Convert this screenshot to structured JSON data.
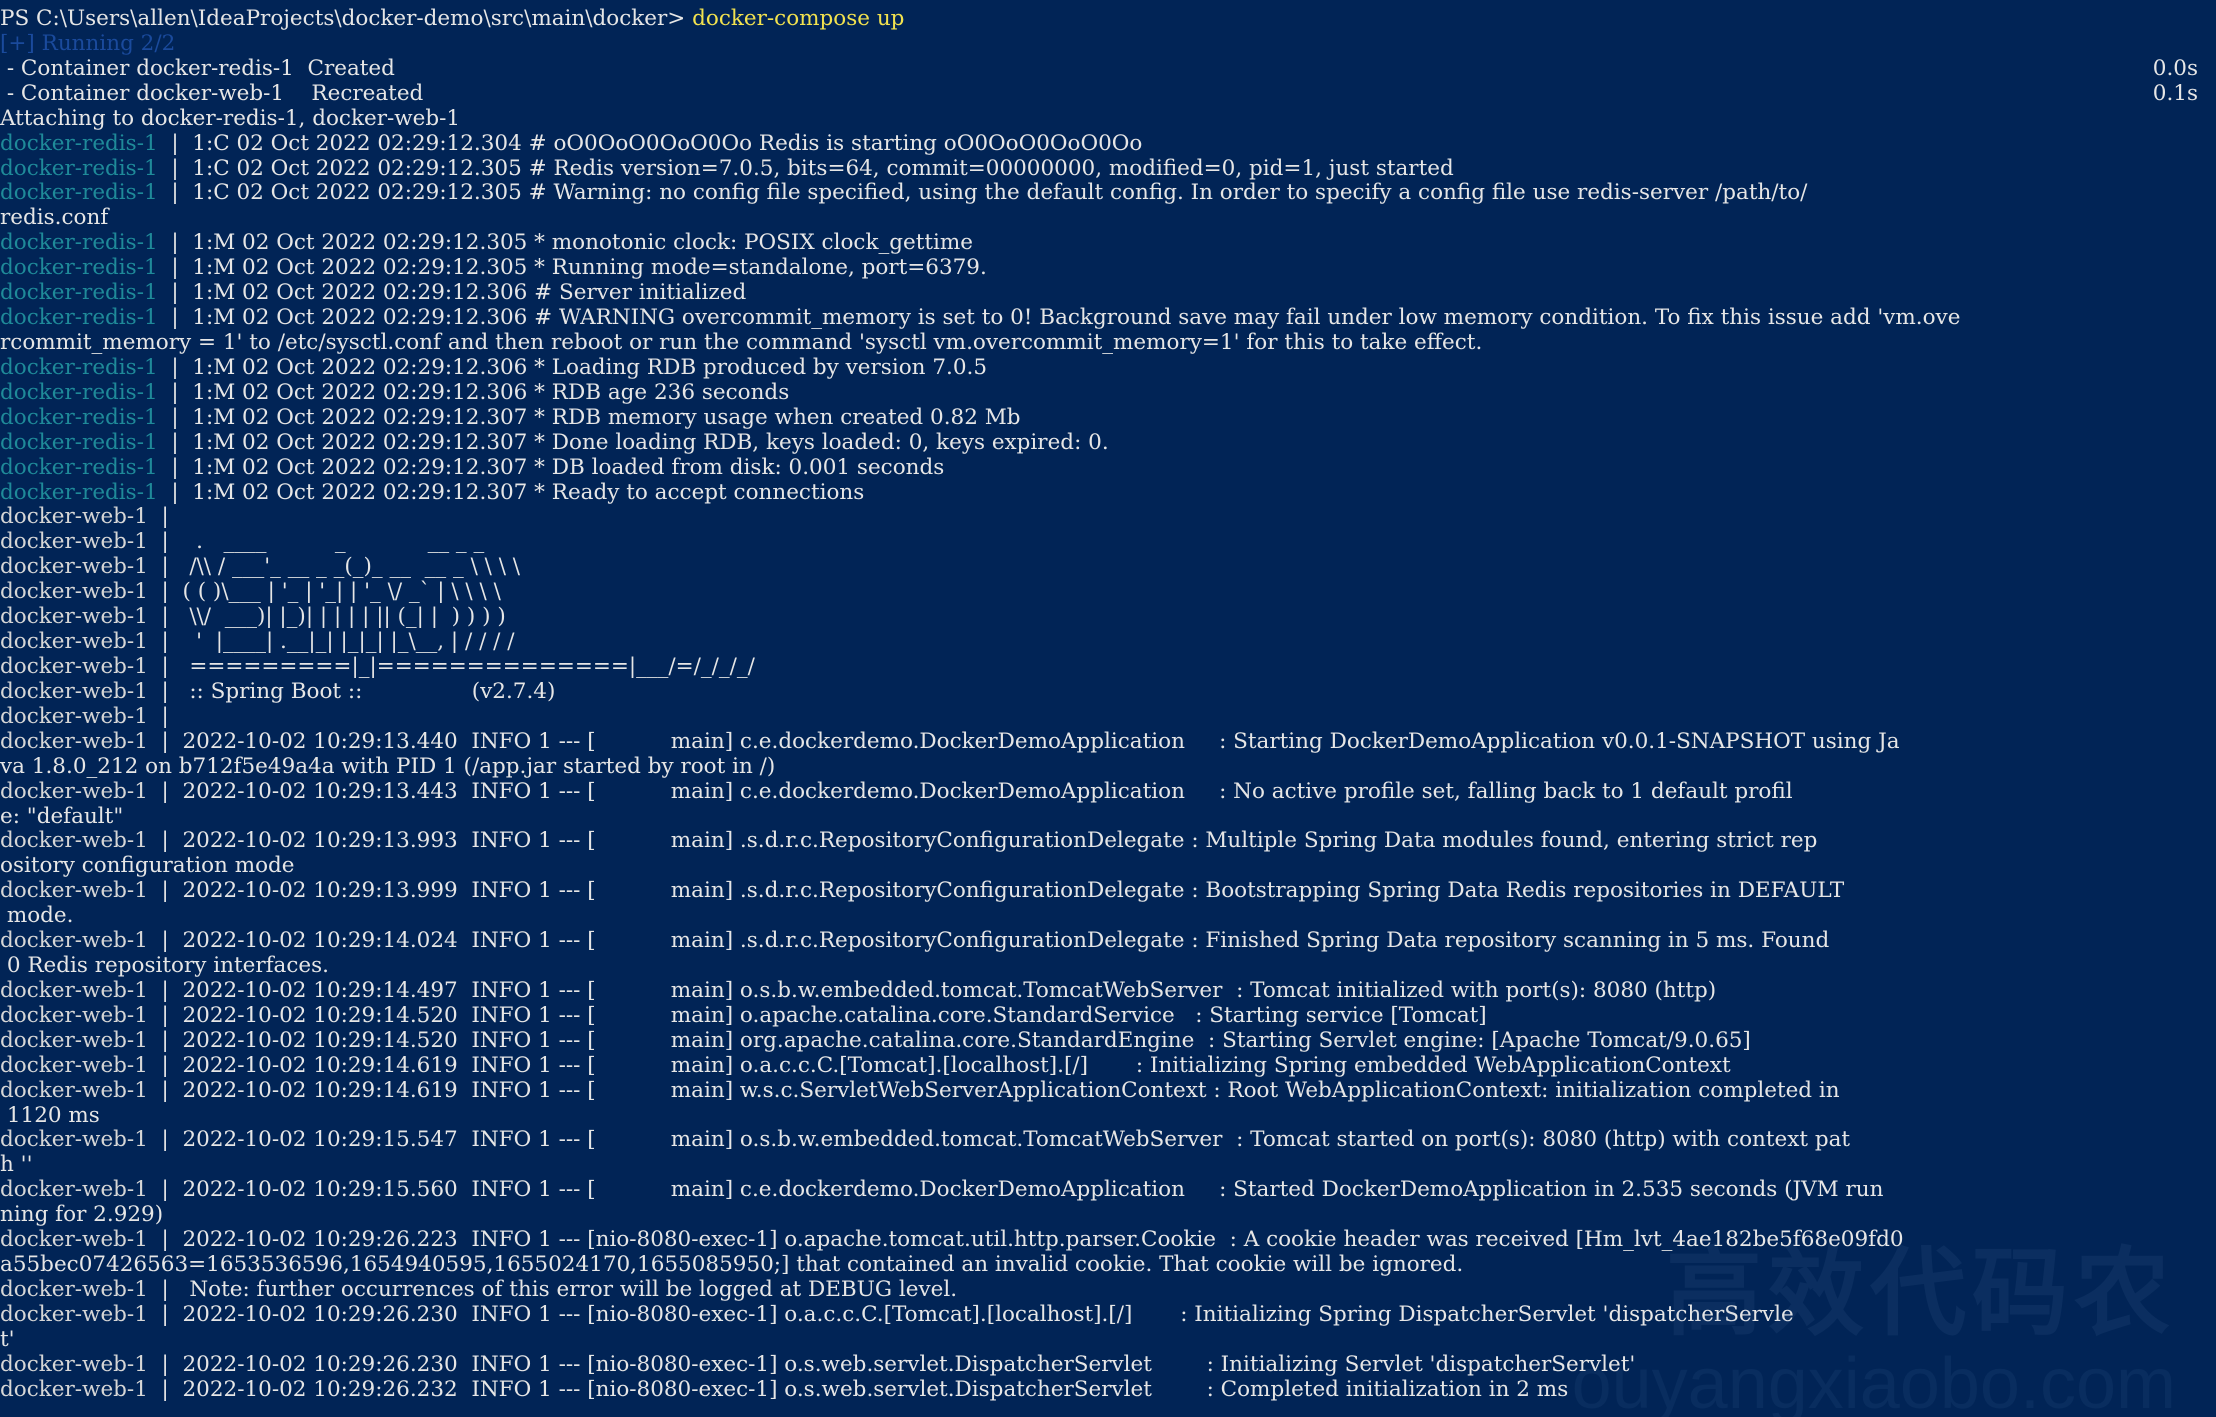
{
  "terminal": {
    "prompt": "PS C:\\Users\\allen\\IdeaProjects\\docker-demo\\src\\main\\docker> ",
    "command": "docker-compose up",
    "running_status": "[+] Running 2/2",
    "containers": [
      {
        "text": " - Container docker-redis-1  Created",
        "time": "0.0s"
      },
      {
        "text": " - Container docker-web-1    Recreated",
        "time": "0.1s"
      }
    ],
    "attaching": "Attaching to docker-redis-1, docker-web-1",
    "watermark": {
      "line1": "高效代码农",
      "line2": "ouyangxiaobo.com"
    }
  },
  "log_lines": [
    {
      "svc": "docker-redis-1",
      "text": "1:C 02 Oct 2022 02:29:12.304 # oO0OoO0OoO0Oo Redis is starting oO0OoO0OoO0Oo"
    },
    {
      "svc": "docker-redis-1",
      "text": "1:C 02 Oct 2022 02:29:12.305 # Redis version=7.0.5, bits=64, commit=00000000, modified=0, pid=1, just started"
    },
    {
      "svc": "docker-redis-1",
      "text": "1:C 02 Oct 2022 02:29:12.305 # Warning: no config file specified, using the default config. In order to specify a config file use redis-server /path/to/"
    },
    {
      "svc": "",
      "text": "redis.conf"
    },
    {
      "svc": "docker-redis-1",
      "text": "1:M 02 Oct 2022 02:29:12.305 * monotonic clock: POSIX clock_gettime"
    },
    {
      "svc": "docker-redis-1",
      "text": "1:M 02 Oct 2022 02:29:12.305 * Running mode=standalone, port=6379."
    },
    {
      "svc": "docker-redis-1",
      "text": "1:M 02 Oct 2022 02:29:12.306 # Server initialized"
    },
    {
      "svc": "docker-redis-1",
      "text": "1:M 02 Oct 2022 02:29:12.306 # WARNING overcommit_memory is set to 0! Background save may fail under low memory condition. To fix this issue add 'vm.ove"
    },
    {
      "svc": "",
      "text": "rcommit_memory = 1' to /etc/sysctl.conf and then reboot or run the command 'sysctl vm.overcommit_memory=1' for this to take effect."
    },
    {
      "svc": "docker-redis-1",
      "text": "1:M 02 Oct 2022 02:29:12.306 * Loading RDB produced by version 7.0.5"
    },
    {
      "svc": "docker-redis-1",
      "text": "1:M 02 Oct 2022 02:29:12.306 * RDB age 236 seconds"
    },
    {
      "svc": "docker-redis-1",
      "text": "1:M 02 Oct 2022 02:29:12.307 * RDB memory usage when created 0.82 Mb"
    },
    {
      "svc": "docker-redis-1",
      "text": "1:M 02 Oct 2022 02:29:12.307 * Done loading RDB, keys loaded: 0, keys expired: 0."
    },
    {
      "svc": "docker-redis-1",
      "text": "1:M 02 Oct 2022 02:29:12.307 * DB loaded from disk: 0.001 seconds"
    },
    {
      "svc": "docker-redis-1",
      "text": "1:M 02 Oct 2022 02:29:12.307 * Ready to accept connections"
    },
    {
      "svc": "docker-web-1",
      "text": ""
    },
    {
      "svc": "docker-web-1",
      "text": "  .   ____          _            __ _ _"
    },
    {
      "svc": "docker-web-1",
      "text": " /\\\\ / ___'_ __ _ _(_)_ __  __ _ \\ \\ \\ \\"
    },
    {
      "svc": "docker-web-1",
      "text": "( ( )\\___ | '_ | '_| | '_ \\/ _` | \\ \\ \\ \\"
    },
    {
      "svc": "docker-web-1",
      "text": " \\\\/  ___)| |_)| | | | | || (_| |  ) ) ) )"
    },
    {
      "svc": "docker-web-1",
      "text": "  '  |____| .__|_| |_|_| |_\\__, | / / / /"
    },
    {
      "svc": "docker-web-1",
      "text": " =========|_|==============|___/=/_/_/_/"
    },
    {
      "svc": "docker-web-1",
      "text": " :: Spring Boot ::                (v2.7.4)"
    },
    {
      "svc": "docker-web-1",
      "text": ""
    },
    {
      "svc": "docker-web-1",
      "text": "2022-10-02 10:29:13.440  INFO 1 --- [           main] c.e.dockerdemo.DockerDemoApplication     : Starting DockerDemoApplication v0.0.1-SNAPSHOT using Ja"
    },
    {
      "svc": "",
      "text": "va 1.8.0_212 on b712f5e49a4a with PID 1 (/app.jar started by root in /)"
    },
    {
      "svc": "docker-web-1",
      "text": "2022-10-02 10:29:13.443  INFO 1 --- [           main] c.e.dockerdemo.DockerDemoApplication     : No active profile set, falling back to 1 default profil"
    },
    {
      "svc": "",
      "text": "e: \"default\""
    },
    {
      "svc": "docker-web-1",
      "text": "2022-10-02 10:29:13.993  INFO 1 --- [           main] .s.d.r.c.RepositoryConfigurationDelegate : Multiple Spring Data modules found, entering strict rep"
    },
    {
      "svc": "",
      "text": "ository configuration mode"
    },
    {
      "svc": "docker-web-1",
      "text": "2022-10-02 10:29:13.999  INFO 1 --- [           main] .s.d.r.c.RepositoryConfigurationDelegate : Bootstrapping Spring Data Redis repositories in DEFAULT"
    },
    {
      "svc": "",
      "text": " mode."
    },
    {
      "svc": "docker-web-1",
      "text": "2022-10-02 10:29:14.024  INFO 1 --- [           main] .s.d.r.c.RepositoryConfigurationDelegate : Finished Spring Data repository scanning in 5 ms. Found"
    },
    {
      "svc": "",
      "text": " 0 Redis repository interfaces."
    },
    {
      "svc": "docker-web-1",
      "text": "2022-10-02 10:29:14.497  INFO 1 --- [           main] o.s.b.w.embedded.tomcat.TomcatWebServer  : Tomcat initialized with port(s): 8080 (http)"
    },
    {
      "svc": "docker-web-1",
      "text": "2022-10-02 10:29:14.520  INFO 1 --- [           main] o.apache.catalina.core.StandardService   : Starting service [Tomcat]"
    },
    {
      "svc": "docker-web-1",
      "text": "2022-10-02 10:29:14.520  INFO 1 --- [           main] org.apache.catalina.core.StandardEngine  : Starting Servlet engine: [Apache Tomcat/9.0.65]"
    },
    {
      "svc": "docker-web-1",
      "text": "2022-10-02 10:29:14.619  INFO 1 --- [           main] o.a.c.c.C.[Tomcat].[localhost].[/]       : Initializing Spring embedded WebApplicationContext"
    },
    {
      "svc": "docker-web-1",
      "text": "2022-10-02 10:29:14.619  INFO 1 --- [           main] w.s.c.ServletWebServerApplicationContext : Root WebApplicationContext: initialization completed in"
    },
    {
      "svc": "",
      "text": " 1120 ms"
    },
    {
      "svc": "docker-web-1",
      "text": "2022-10-02 10:29:15.547  INFO 1 --- [           main] o.s.b.w.embedded.tomcat.TomcatWebServer  : Tomcat started on port(s): 8080 (http) with context pat"
    },
    {
      "svc": "",
      "text": "h ''"
    },
    {
      "svc": "docker-web-1",
      "text": "2022-10-02 10:29:15.560  INFO 1 --- [           main] c.e.dockerdemo.DockerDemoApplication     : Started DockerDemoApplication in 2.535 seconds (JVM run"
    },
    {
      "svc": "",
      "text": "ning for 2.929)"
    },
    {
      "svc": "docker-web-1",
      "text": "2022-10-02 10:29:26.223  INFO 1 --- [nio-8080-exec-1] o.apache.tomcat.util.http.parser.Cookie  : A cookie header was received [Hm_lvt_4ae182be5f68e09fd0"
    },
    {
      "svc": "",
      "text": "a55bec07426563=1653536596,1654940595,1655024170,1655085950;] that contained an invalid cookie. That cookie will be ignored."
    },
    {
      "svc": "docker-web-1",
      "text": " Note: further occurrences of this error will be logged at DEBUG level."
    },
    {
      "svc": "docker-web-1",
      "text": "2022-10-02 10:29:26.230  INFO 1 --- [nio-8080-exec-1] o.a.c.c.C.[Tomcat].[localhost].[/]       : Initializing Spring DispatcherServlet 'dispatcherServle"
    },
    {
      "svc": "",
      "text": "t'"
    },
    {
      "svc": "docker-web-1",
      "text": "2022-10-02 10:29:26.230  INFO 1 --- [nio-8080-exec-1] o.s.web.servlet.DispatcherServlet        : Initializing Servlet 'dispatcherServlet'"
    },
    {
      "svc": "docker-web-1",
      "text": "2022-10-02 10:29:26.232  INFO 1 --- [nio-8080-exec-1] o.s.web.servlet.DispatcherServlet        : Completed initialization in 2 ms"
    }
  ]
}
